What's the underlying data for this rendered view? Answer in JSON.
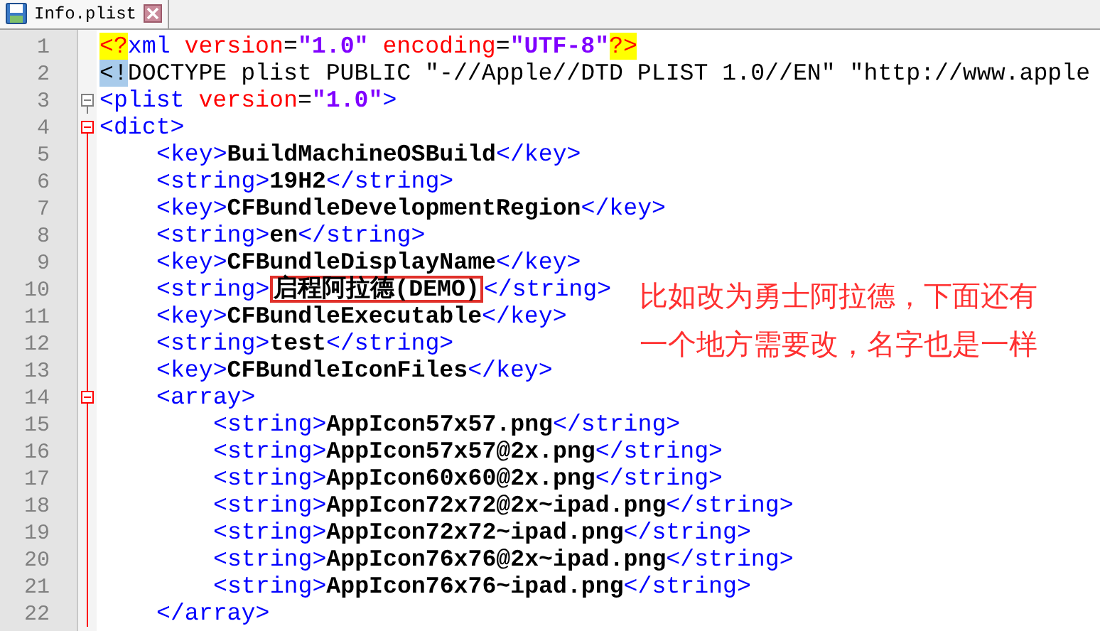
{
  "tab": {
    "title": "Info.plist",
    "selected": true
  },
  "lines": [
    {
      "number": "1",
      "tokens": [
        {
          "kind": "pi",
          "text": "<?"
        },
        {
          "kind": "tag",
          "text": "xml "
        },
        {
          "kind": "attr",
          "text": "version"
        },
        {
          "kind": "plain",
          "text": "="
        },
        {
          "kind": "value",
          "text": "\"1.0\" "
        },
        {
          "kind": "attr",
          "text": "encoding"
        },
        {
          "kind": "plain",
          "text": "="
        },
        {
          "kind": "value",
          "text": "\"UTF-8\""
        },
        {
          "kind": "pi",
          "text": "?>"
        }
      ]
    },
    {
      "number": "2",
      "tokens": [
        {
          "kind": "mark",
          "text": "<!"
        },
        {
          "kind": "plain",
          "text": "DOCTYPE plist PUBLIC \"-//Apple//DTD PLIST 1.0//EN\" \"http://www.apple"
        }
      ]
    },
    {
      "number": "3",
      "expanded": true,
      "tokens": [
        {
          "kind": "tag",
          "text": "<plist "
        },
        {
          "kind": "attr",
          "text": "version"
        },
        {
          "kind": "plain",
          "text": "="
        },
        {
          "kind": "value",
          "text": "\"1.0\""
        },
        {
          "kind": "tag",
          "text": ">"
        }
      ]
    },
    {
      "number": "4",
      "expanded": true,
      "current": true,
      "tokens": [
        {
          "kind": "tag",
          "text": "<dict>"
        }
      ],
      "children": [
        {
          "number": "5",
          "tokens": [
            {
              "kind": "tag",
              "text": "<key>"
            },
            {
              "kind": "text",
              "text": "BuildMachineOSBuild"
            },
            {
              "kind": "tag",
              "text": "</key>"
            }
          ]
        },
        {
          "number": "6",
          "tokens": [
            {
              "kind": "tag",
              "text": "<string>"
            },
            {
              "kind": "text",
              "text": "19H2"
            },
            {
              "kind": "tag",
              "text": "</string>"
            }
          ]
        },
        {
          "number": "7",
          "tokens": [
            {
              "kind": "tag",
              "text": "<key>"
            },
            {
              "kind": "text",
              "text": "CFBundleDevelopmentRegion"
            },
            {
              "kind": "tag",
              "text": "</key>"
            }
          ]
        },
        {
          "number": "8",
          "tokens": [
            {
              "kind": "tag",
              "text": "<string>"
            },
            {
              "kind": "text",
              "text": "en"
            },
            {
              "kind": "tag",
              "text": "</string>"
            }
          ]
        },
        {
          "number": "9",
          "tokens": [
            {
              "kind": "tag",
              "text": "<key>"
            },
            {
              "kind": "text",
              "text": "CFBundleDisplayName"
            },
            {
              "kind": "tag",
              "text": "</key>"
            }
          ]
        },
        {
          "number": "10",
          "tokens": [
            {
              "kind": "tag",
              "text": "<string>"
            },
            {
              "kind": "cjk",
              "text": "启程阿拉德",
              "outlined": true
            },
            {
              "kind": "text",
              "text": "(DEMO)",
              "outlined": true
            },
            {
              "kind": "tag",
              "text": "</string>"
            }
          ]
        },
        {
          "number": "11",
          "tokens": [
            {
              "kind": "tag",
              "text": "<key>"
            },
            {
              "kind": "text",
              "text": "CFBundleExecutable"
            },
            {
              "kind": "tag",
              "text": "</key>"
            }
          ]
        },
        {
          "number": "12",
          "tokens": [
            {
              "kind": "tag",
              "text": "<string>"
            },
            {
              "kind": "text",
              "text": "test"
            },
            {
              "kind": "tag",
              "text": "</string>"
            }
          ]
        },
        {
          "number": "13",
          "tokens": [
            {
              "kind": "tag",
              "text": "<key>"
            },
            {
              "kind": "text",
              "text": "CFBundleIconFiles"
            },
            {
              "kind": "tag",
              "text": "</key>"
            }
          ]
        },
        {
          "number": "14",
          "expanded": true,
          "tokens": [
            {
              "kind": "tag",
              "text": "<array>"
            }
          ],
          "children": [
            {
              "number": "15",
              "tokens": [
                {
                  "kind": "tag",
                  "text": "<string>"
                },
                {
                  "kind": "text",
                  "text": "AppIcon57x57.png"
                },
                {
                  "kind": "tag",
                  "text": "</string>"
                }
              ]
            },
            {
              "number": "16",
              "tokens": [
                {
                  "kind": "tag",
                  "text": "<string>"
                },
                {
                  "kind": "text",
                  "text": "AppIcon57x57@2x.png"
                },
                {
                  "kind": "tag",
                  "text": "</string>"
                }
              ]
            },
            {
              "number": "17",
              "tokens": [
                {
                  "kind": "tag",
                  "text": "<string>"
                },
                {
                  "kind": "text",
                  "text": "AppIcon60x60@2x.png"
                },
                {
                  "kind": "tag",
                  "text": "</string>"
                }
              ]
            },
            {
              "number": "18",
              "tokens": [
                {
                  "kind": "tag",
                  "text": "<string>"
                },
                {
                  "kind": "text",
                  "text": "AppIcon72x72@2x~ipad.png"
                },
                {
                  "kind": "tag",
                  "text": "</string>"
                }
              ]
            },
            {
              "number": "19",
              "tokens": [
                {
                  "kind": "tag",
                  "text": "<string>"
                },
                {
                  "kind": "text",
                  "text": "AppIcon72x72~ipad.png"
                },
                {
                  "kind": "tag",
                  "text": "</string>"
                }
              ]
            },
            {
              "number": "20",
              "tokens": [
                {
                  "kind": "tag",
                  "text": "<string>"
                },
                {
                  "kind": "text",
                  "text": "AppIcon76x76@2x~ipad.png"
                },
                {
                  "kind": "tag",
                  "text": "</string>"
                }
              ]
            },
            {
              "number": "21",
              "tokens": [
                {
                  "kind": "tag",
                  "text": "<string>"
                },
                {
                  "kind": "text",
                  "text": "AppIcon76x76~ipad.png"
                },
                {
                  "kind": "tag",
                  "text": "</string>"
                }
              ]
            }
          ]
        },
        {
          "number": "22",
          "tokens": [
            {
              "kind": "tag",
              "text": "</array>"
            }
          ]
        }
      ]
    }
  ],
  "annotation": [
    "比如改为勇士阿拉德，下面还有",
    "一个地方需要改，名字也是一样"
  ]
}
